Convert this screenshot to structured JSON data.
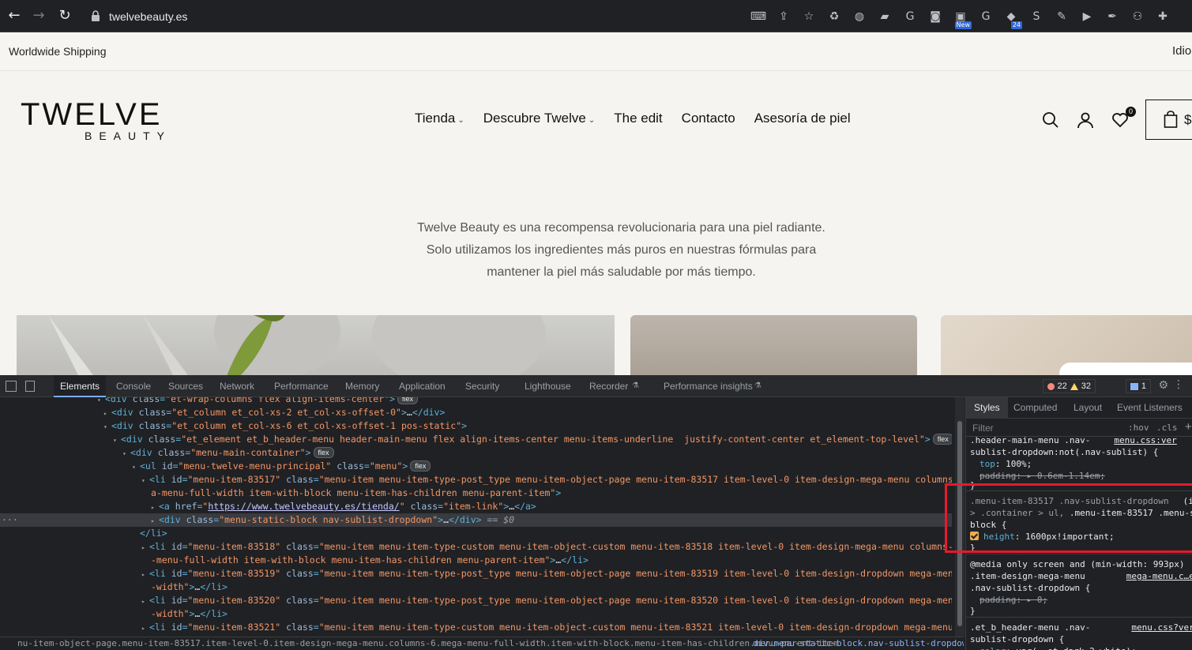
{
  "browser": {
    "url": "twelvebeauty.es",
    "extensions": [
      {
        "icon": "translate-icon",
        "glyph": "⌨"
      },
      {
        "icon": "share-icon",
        "glyph": "⇪"
      },
      {
        "icon": "star-icon",
        "glyph": "☆"
      },
      {
        "icon": "recycle-icon",
        "glyph": "♻"
      },
      {
        "icon": "globe-icon",
        "glyph": "◍"
      },
      {
        "icon": "cast-icon",
        "glyph": "▰"
      },
      {
        "icon": "google-translate-icon",
        "glyph": "G"
      },
      {
        "icon": "camera-icon",
        "glyph": "◙"
      },
      {
        "icon": "new-extension-icon",
        "glyph": "▣",
        "badge": "New"
      },
      {
        "icon": "grammarly-icon",
        "glyph": "G"
      },
      {
        "icon": "calendar-extension-icon",
        "glyph": "◆",
        "badge": "24"
      },
      {
        "icon": "s-extension-icon",
        "glyph": "S"
      },
      {
        "icon": "pen-icon",
        "glyph": "✎"
      },
      {
        "icon": "video-icon",
        "glyph": "▶"
      },
      {
        "icon": "feather-icon",
        "glyph": "✒"
      },
      {
        "icon": "network-icon",
        "glyph": "⚇"
      },
      {
        "icon": "puzzle-icon",
        "glyph": "✚"
      }
    ]
  },
  "site": {
    "topbar": {
      "shipping": "Worldwide Shipping",
      "language": "Idio"
    },
    "logo": {
      "main": "TWELVE",
      "sub": "BEAUTY"
    },
    "nav": [
      {
        "label": "Tienda",
        "dropdown": true
      },
      {
        "label": "Descubre Twelve",
        "dropdown": true
      },
      {
        "label": "The edit",
        "dropdown": false
      },
      {
        "label": "Contacto",
        "dropdown": false
      },
      {
        "label": "Asesoría de piel",
        "dropdown": false
      }
    ],
    "wishlist_count": "0",
    "cart_currency": "$",
    "tagline": [
      "Twelve Beauty es una recompensa revolucionaria para una piel radiante.",
      "Solo utilizamos los ingredientes más puros en nuestras fórmulas para",
      "mantener la piel más saludable por más tiempo."
    ]
  },
  "devtools": {
    "tabs": [
      "Elements",
      "Console",
      "Sources",
      "Network",
      "Performance",
      "Memory",
      "Application",
      "Security",
      "Lighthouse",
      "Recorder",
      "Performance insights"
    ],
    "active_tab": "Elements",
    "errors": "22",
    "warnings": "32",
    "messages": "1",
    "breadcrumb_1": "nu-item-object-page.menu-item-83517.item-level-0.item-design-mega-menu.columns-6.mega-menu-full-width.item-with-block.menu-item-has-children.menu-parent-item",
    "breadcrumb_2": "div.menu-static-block.nav-sublist-dropdown",
    "styles_tabs": [
      "Styles",
      "Computed",
      "Layout",
      "Event Listeners"
    ],
    "filter_placeholder": "Filter",
    "hov": ":hov",
    "cls": ".cls"
  }
}
